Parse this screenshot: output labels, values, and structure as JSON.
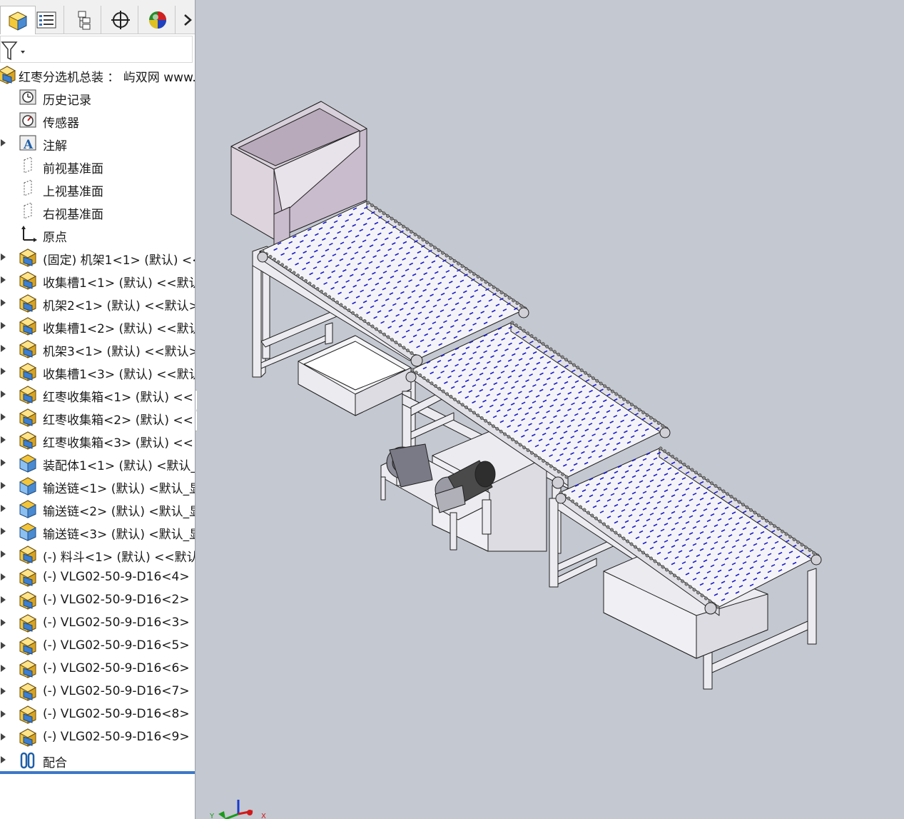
{
  "panel": {
    "tabs": [
      {
        "icon": "feature-manager-icon",
        "active": true
      },
      {
        "icon": "property-manager-icon",
        "active": false
      },
      {
        "icon": "configuration-manager-icon",
        "active": false
      },
      {
        "icon": "dimxpert-icon",
        "active": false
      },
      {
        "icon": "display-manager-icon",
        "active": false
      }
    ],
    "more_icon": "chevron-right-icon",
    "filter_icon": "filter-icon"
  },
  "tree": {
    "root": "红枣分选机总装 ： 屿双网 www.",
    "items": [
      {
        "label": "历史记录",
        "icon": "history-icon",
        "expandable": false
      },
      {
        "label": "传感器",
        "icon": "sensor-icon",
        "expandable": false
      },
      {
        "label": "注解",
        "icon": "annotation-icon",
        "expandable": true
      },
      {
        "label": "前视基准面",
        "icon": "plane-icon",
        "expandable": false
      },
      {
        "label": "上视基准面",
        "icon": "plane-icon",
        "expandable": false
      },
      {
        "label": "右视基准面",
        "icon": "plane-icon",
        "expandable": false
      },
      {
        "label": "原点",
        "icon": "origin-icon",
        "expandable": false
      },
      {
        "label": "(固定) 机架1<1> (默认) <<",
        "icon": "part-icon",
        "expandable": true
      },
      {
        "label": "收集槽1<1> (默认) <<默认",
        "icon": "part-icon",
        "expandable": true
      },
      {
        "label": "机架2<1> (默认) <<默认>",
        "icon": "part-icon",
        "expandable": true
      },
      {
        "label": "收集槽1<2> (默认) <<默认",
        "icon": "part-icon",
        "expandable": true
      },
      {
        "label": "机架3<1> (默认) <<默认>",
        "icon": "part-icon",
        "expandable": true
      },
      {
        "label": "收集槽1<3> (默认) <<默认",
        "icon": "part-icon",
        "expandable": true
      },
      {
        "label": "红枣收集箱<1> (默认) <<!",
        "icon": "part-icon",
        "expandable": true
      },
      {
        "label": "红枣收集箱<2> (默认) <<!",
        "icon": "part-icon",
        "expandable": true
      },
      {
        "label": "红枣收集箱<3> (默认) <<!",
        "icon": "part-icon",
        "expandable": true
      },
      {
        "label": "装配体1<1> (默认) <默认_",
        "icon": "subassembly-icon",
        "expandable": true
      },
      {
        "label": "输送链<1> (默认) <默认_显",
        "icon": "subassembly-icon",
        "expandable": true
      },
      {
        "label": "输送链<2> (默认) <默认_显",
        "icon": "subassembly-icon",
        "expandable": true
      },
      {
        "label": "输送链<3> (默认) <默认_显",
        "icon": "subassembly-icon",
        "expandable": true
      },
      {
        "label": "(-) 料斗<1> (默认) <<默认",
        "icon": "part-icon",
        "expandable": true
      },
      {
        "label": "(-) VLG02-50-9-D16<4>",
        "icon": "part-icon",
        "expandable": true
      },
      {
        "label": "(-) VLG02-50-9-D16<2>",
        "icon": "part-icon",
        "expandable": true
      },
      {
        "label": "(-) VLG02-50-9-D16<3>",
        "icon": "part-icon",
        "expandable": true
      },
      {
        "label": "(-) VLG02-50-9-D16<5>",
        "icon": "part-icon",
        "expandable": true
      },
      {
        "label": "(-) VLG02-50-9-D16<6>",
        "icon": "part-icon",
        "expandable": true
      },
      {
        "label": "(-) VLG02-50-9-D16<7>",
        "icon": "part-icon",
        "expandable": true
      },
      {
        "label": "(-) VLG02-50-9-D16<8>",
        "icon": "part-icon",
        "expandable": true
      },
      {
        "label": "(-) VLG02-50-9-D16<9>",
        "icon": "part-icon",
        "expandable": true
      },
      {
        "label": "配合",
        "icon": "mates-icon",
        "expandable": true
      }
    ]
  },
  "viewport": {
    "background": "#c4c8d1",
    "triad_labels": {
      "x": "X",
      "y": "Y"
    }
  },
  "colors": {
    "frame": "#ecebf0",
    "frame_stroke": "#202020",
    "hopper": "#c9bccc",
    "belt_dash": "#1c1cd0",
    "motor": "#4a4a4a"
  }
}
